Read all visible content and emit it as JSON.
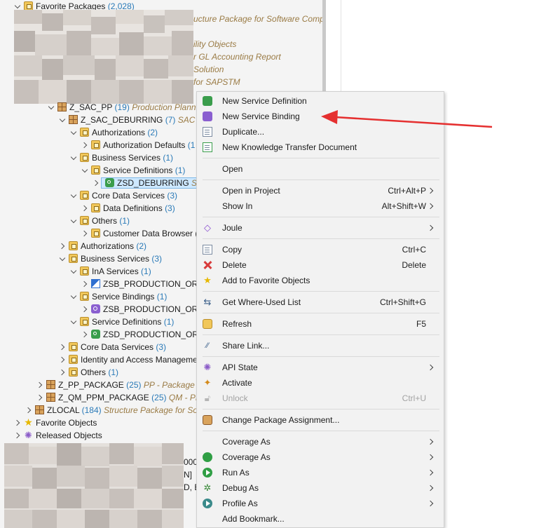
{
  "tree": {
    "favorite_packages": {
      "label": "Favorite Packages",
      "count": "(2,028)"
    },
    "peek_descs": [
      "ucture Package for Software Comp",
      "ility Objects",
      "r GL Accounting Report",
      "Solution",
      "for SAPSTM"
    ],
    "z_sac_pp": {
      "label": "Z_SAC_PP",
      "count": "(19)",
      "desc": "Production Plannin"
    },
    "z_sac_deburring": {
      "label": "Z_SAC_DEBURRING",
      "count": "(7)",
      "desc": "SAC P"
    },
    "authorizations_1": {
      "label": "Authorizations",
      "count": "(2)"
    },
    "authorization_defaults": {
      "label": "Authorization Defaults",
      "count": "(1"
    },
    "business_services_1": {
      "label": "Business Services",
      "count": "(1)"
    },
    "service_definitions_1": {
      "label": "Service Definitions",
      "count": "(1)"
    },
    "zsd_deburring": {
      "label": "ZSD_DEBURRING",
      "desc": "Ser"
    },
    "core_data_services_1": {
      "label": "Core Data Services",
      "count": "(3)"
    },
    "data_definitions": {
      "label": "Data Definitions",
      "count": "(3)"
    },
    "others_1": {
      "label": "Others",
      "count": "(1)"
    },
    "customer_data_browser": {
      "label": "Customer Data Browser ("
    },
    "authorizations_2": {
      "label": "Authorizations",
      "count": "(2)"
    },
    "business_services_2": {
      "label": "Business Services",
      "count": "(3)"
    },
    "ina_services": {
      "label": "InA Services",
      "count": "(1)"
    },
    "zsb_production_1": {
      "label": "ZSB_PRODUCTION_ORD"
    },
    "service_bindings": {
      "label": "Service Bindings",
      "count": "(1)"
    },
    "zsb_production_2": {
      "label": "ZSB_PRODUCTION_ORD"
    },
    "service_definitions_2": {
      "label": "Service Definitions",
      "count": "(1)"
    },
    "zsd_production": {
      "label": "ZSD_PRODUCTION_ORD"
    },
    "core_data_services_2": {
      "label": "Core Data Services",
      "count": "(3)"
    },
    "identity_access": {
      "label": "Identity and Access Manageme"
    },
    "others_2": {
      "label": "Others",
      "count": "(1)"
    },
    "z_pp_package": {
      "label": "Z_PP_PACKAGE",
      "count": "(25)",
      "desc": "PP - Package"
    },
    "z_qm_ppm_package": {
      "label": "Z_QM_PPM_PACKAGE",
      "count": "(25)",
      "desc": "QM - PP"
    },
    "zlocal": {
      "label": "ZLOCAL",
      "count": "(184)",
      "desc": "Structure Package for So"
    },
    "favorite_objects": {
      "label": "Favorite Objects"
    },
    "released_objects": {
      "label": "Released Objects"
    },
    "peek_lower": [
      "000",
      "N]",
      "D, EN"
    ]
  },
  "context_menu": {
    "new_service_definition": {
      "label": "New Service Definition"
    },
    "new_service_binding": {
      "label": "New Service Binding"
    },
    "duplicate": {
      "label": "Duplicate..."
    },
    "new_ktd": {
      "label": "New Knowledge Transfer Document"
    },
    "open": {
      "label": "Open"
    },
    "open_in_project": {
      "label": "Open in Project",
      "shortcut": "Ctrl+Alt+P"
    },
    "show_in": {
      "label": "Show In",
      "shortcut": "Alt+Shift+W"
    },
    "joule": {
      "label": "Joule"
    },
    "copy": {
      "label": "Copy",
      "shortcut": "Ctrl+C"
    },
    "delete": {
      "label": "Delete",
      "shortcut": "Delete"
    },
    "add_favorite": {
      "label": "Add to Favorite Objects"
    },
    "where_used": {
      "label": "Get Where-Used List",
      "shortcut": "Ctrl+Shift+G"
    },
    "refresh": {
      "label": "Refresh",
      "shortcut": "F5"
    },
    "share_link": {
      "label": "Share Link..."
    },
    "api_state": {
      "label": "API State"
    },
    "activate": {
      "label": "Activate"
    },
    "unlock": {
      "label": "Unlock",
      "shortcut": "Ctrl+U"
    },
    "change_package": {
      "label": "Change Package Assignment..."
    },
    "coverage_as_1": {
      "label": "Coverage As"
    },
    "coverage_as_2": {
      "label": "Coverage As"
    },
    "run_as": {
      "label": "Run As"
    },
    "debug_as": {
      "label": "Debug As"
    },
    "profile_as": {
      "label": "Profile As"
    },
    "add_bookmark": {
      "label": "Add Bookmark..."
    }
  },
  "colors": {
    "arrow": "#e53030",
    "accent": "#2a7ab8",
    "menu_bg": "#f2f2f2"
  }
}
